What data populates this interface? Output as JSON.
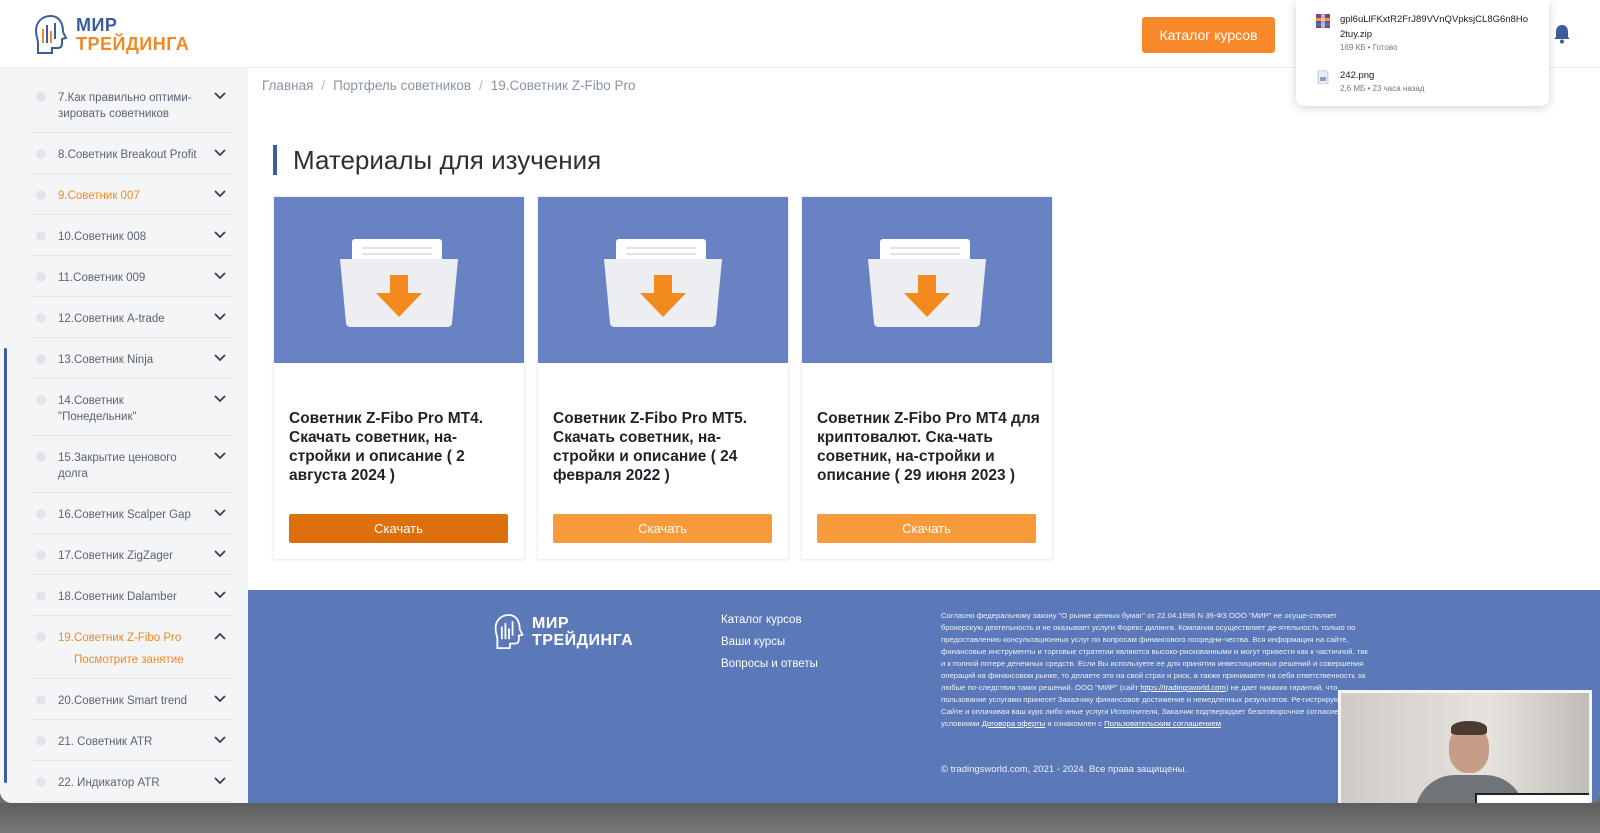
{
  "header": {
    "logo_line1": "МИР",
    "logo_line2": "ТРЕЙДИНГА",
    "catalog_button": "Каталог курсов"
  },
  "downloads": [
    {
      "name": "gpl6uLlFKxtR2FrJ89VVnQVpksjCL8G6n8Ho2tuy.zip",
      "meta": "169 КБ • Готово"
    },
    {
      "name": "242.png",
      "meta": "2,6 МБ • 23 часа назад"
    }
  ],
  "sidebar": {
    "items": [
      {
        "label": "7.Как правильно оптими-зировать советников"
      },
      {
        "label": "8.Советник Breakout Profit"
      },
      {
        "label": "9.Советник 007"
      },
      {
        "label": "10.Советник 008"
      },
      {
        "label": "11.Советник 009"
      },
      {
        "label": "12.Советник A-trade"
      },
      {
        "label": "13.Советник Ninja"
      },
      {
        "label": "14.Советник \"Понедельник\""
      },
      {
        "label": "15.Закрытие ценового долга"
      },
      {
        "label": "16.Советник Scalper Gap"
      },
      {
        "label": "17.Советник ZigZager"
      },
      {
        "label": "18.Советник Dalamber"
      },
      {
        "label": "19.Советник Z-Fibo Pro",
        "sub": "Посмотрите занятие"
      },
      {
        "label": "20.Советник Smart trend"
      },
      {
        "label": "21. Советник ATR"
      },
      {
        "label": "22. Индикатор ATR"
      }
    ]
  },
  "breadcrumb": [
    "Главная",
    "Портфель советников",
    "19.Советник Z-Fibo Pro"
  ],
  "section_title": "Материалы для изучения",
  "cards": [
    {
      "title": "Советник Z-Fibo Pro MT4. Скачать советник, на-стройки и описание ( 2 августа 2024 )",
      "button": "Скачать"
    },
    {
      "title": "Советник Z-Fibo Pro MT5. Скачать советник, на-стройки и описание ( 24 февраля 2022 )",
      "button": "Скачать"
    },
    {
      "title": "Советник Z-Fibo Pro MT4 для криптовалют. Ска-чать советник, на-стройки и описание ( 29 июня 2023 )",
      "button": "Скачать"
    }
  ],
  "footer": {
    "logo_line1": "МИР",
    "logo_line2": "ТРЕЙДИНГА",
    "links": [
      "Каталог курсов",
      "Ваши курсы",
      "Вопросы и ответы"
    ],
    "legal_1": "Согласно федеральному закону \"О рынке ценных бумаг\" от 22.04.1996 N 39-ФЗ ООО \"МИР\" не осуще-ствляет брокерскую деятельность и не оказывает услуги Форекс дилинга. Компания осуществляет де-ятельность только по предоставлению консультационных услуг по вопросам финансового посредни-чества. Вся информация на сайте, финансовые инструменты и торговые стратегии являются высоко-рискованными и могут привести как к частичной, так и к полной потере денежных средств. Если Вы используете ее для принятия инвестиционных решений и совершения операций на финансовом рынке, то делаете это на свой страх и риск, а также принимаете на себя ответственность за любые по-следствия таких решений. ООО \"МИР\" (сайт ",
    "legal_link1": "https://tradingsworld.com",
    "legal_2": ") не дает никаких гарантий, что пользование услугами принесет Заказчику финансовое достижение и немедленных результатов. Ре-гистрируясь на Сайте и оплачивая ваш курс либо иные услуги Исполнителя, Заказчик подтверждает безоговорочное согласие со всеми условиями ",
    "legal_link2": "Договора оферты",
    "legal_3": " и ознакомлен с ",
    "legal_link3": "Пользовательским соглашением",
    "copyright": "© tradingsworld.com, 2021 - 2024. Все права защищены."
  },
  "colors": {
    "brand_blue": "#3d5c9e",
    "brand_orange": "#f08a24",
    "footer_bg": "#5b78b8",
    "card_thumb": "#6882c3"
  }
}
